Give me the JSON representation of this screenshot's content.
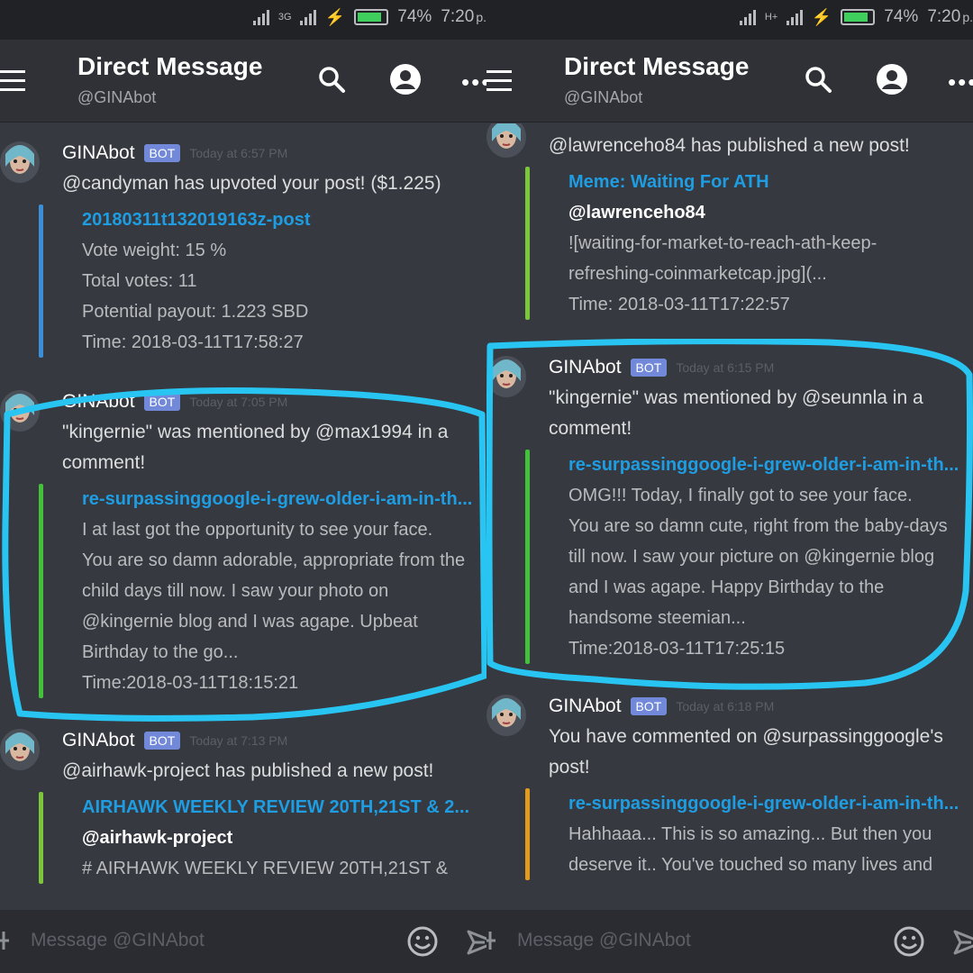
{
  "status_bar": {
    "battery": "74%",
    "time": "7:20",
    "time_suffix": "p.",
    "network_left": "3G",
    "network_right": "H+"
  },
  "header": {
    "title": "Direct Message",
    "subtitle": "@GINAbot"
  },
  "input": {
    "placeholder": "Message @GINAbot"
  },
  "colors": {
    "accent": "#7289da",
    "link": "#1e9de3",
    "highlight_circle": "#29c5f2",
    "bar_blue": "#3a8fd8",
    "bar_green": "#43b581",
    "bar_lime": "#7bc63a",
    "bar_orange": "#e39b1e"
  },
  "left_panel": {
    "messages": [
      {
        "author": "GINAbot",
        "badge": "BOT",
        "time": "Today at 6:57 PM",
        "text": [
          "@candyman has upvoted your post! ($1.225)"
        ],
        "embed": {
          "color": "#3a8fd8",
          "title": "20180311t132019163z-post",
          "lines": [
            "Vote weight: 15 %",
            "Total votes: 11",
            "Potential payout: 1.223 SBD",
            "Time: 2018-03-11T17:58:27"
          ]
        }
      },
      {
        "author": "GINAbot",
        "badge": "BOT",
        "time": "Today at 7:05 PM",
        "text": [
          "\"kingernie\" was mentioned by @max1994 in a",
          "comment!"
        ],
        "embed": {
          "color": "#43c13a",
          "title": "re-surpassinggoogle-i-grew-older-i-am-in-th...",
          "lines": [
            "I at last got the opportunity to see your face.",
            "You are so damn adorable, appropriate from the",
            "child days till now.   I saw your photo on",
            "@kingernie blog and I was agape.   Upbeat",
            "Birthday to the go...",
            "Time:2018-03-11T18:15:21"
          ]
        }
      },
      {
        "author": "GINAbot",
        "badge": "BOT",
        "time": "Today at 7:13 PM",
        "text": [
          "@airhawk-project has published a new post!"
        ],
        "embed": {
          "color": "#7bc63a",
          "title": "AIRHAWK WEEKLY REVIEW 20TH,21ST & 2...",
          "author": "@airhawk-project",
          "lines": [
            "# AIRHAWK WEEKLY REVIEW 20TH,21ST &"
          ]
        }
      }
    ]
  },
  "right_panel": {
    "messages": [
      {
        "text": [
          "@lawrenceho84 has published a new post!"
        ],
        "embed": {
          "color": "#7bc63a",
          "title": "Meme: Waiting For ATH",
          "author": "@lawrenceho84",
          "lines": [
            "![waiting-for-market-to-reach-ath-keep-",
            "refreshing-coinmarketcap.jpg](...",
            "Time: 2018-03-11T17:22:57"
          ]
        }
      },
      {
        "author": "GINAbot",
        "badge": "BOT",
        "time": "Today at 6:15 PM",
        "text": [
          "\"kingernie\" was mentioned by @seunnla in a",
          "comment!"
        ],
        "embed": {
          "color": "#43c13a",
          "title": "re-surpassinggoogle-i-grew-older-i-am-in-th...",
          "lines": [
            "OMG!!!  Today, I finally got to see your face.",
            "You are so damn cute, right from the baby-days",
            "till now.  I saw your picture on @kingernie blog",
            "and I was agape.  Happy Birthday to the",
            "handsome steemian...",
            "Time:2018-03-11T17:25:15"
          ]
        }
      },
      {
        "author": "GINAbot",
        "badge": "BOT",
        "time": "Today at 6:18 PM",
        "text": [
          "You have commented on @surpassinggoogle's",
          "post!"
        ],
        "embed": {
          "color": "#e39b1e",
          "title": "re-surpassinggoogle-i-grew-older-i-am-in-th...",
          "lines": [
            "Hahhaaa... This is so amazing...  But then you",
            "deserve it..  You've touched so many lives and"
          ]
        }
      }
    ]
  }
}
